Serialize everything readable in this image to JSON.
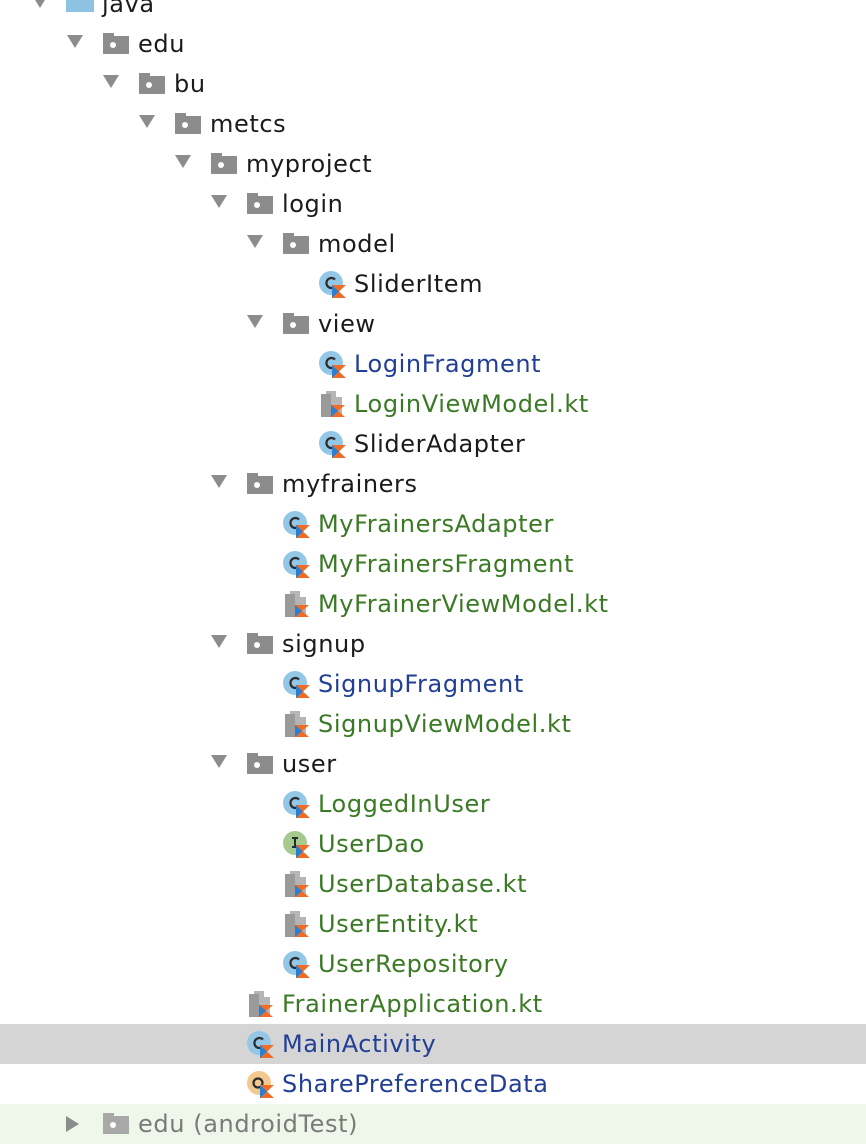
{
  "tree": {
    "nodes": [
      {
        "label": "java",
        "kind": "folder"
      },
      {
        "label": "edu",
        "kind": "package"
      },
      {
        "label": "bu",
        "kind": "package"
      },
      {
        "label": "metcs",
        "kind": "package"
      },
      {
        "label": "myproject",
        "kind": "package"
      },
      {
        "label": "login",
        "kind": "package"
      },
      {
        "label": "model",
        "kind": "package"
      },
      {
        "label": "SliderItem",
        "kind": "kotlin-class"
      },
      {
        "label": "view",
        "kind": "package"
      },
      {
        "label": "LoginFragment",
        "kind": "kotlin-class"
      },
      {
        "label": "LoginViewModel.kt",
        "kind": "kotlin-file"
      },
      {
        "label": "SliderAdapter",
        "kind": "kotlin-class"
      },
      {
        "label": "myfrainers",
        "kind": "package"
      },
      {
        "label": "MyFrainersAdapter",
        "kind": "kotlin-class"
      },
      {
        "label": "MyFrainersFragment",
        "kind": "kotlin-class"
      },
      {
        "label": "MyFrainerViewModel.kt",
        "kind": "kotlin-file"
      },
      {
        "label": "signup",
        "kind": "package"
      },
      {
        "label": "SignupFragment",
        "kind": "kotlin-class"
      },
      {
        "label": "SignupViewModel.kt",
        "kind": "kotlin-file"
      },
      {
        "label": "user",
        "kind": "package"
      },
      {
        "label": "LoggedInUser",
        "kind": "kotlin-class"
      },
      {
        "label": "UserDao",
        "kind": "kotlin-interface"
      },
      {
        "label": "UserDatabase.kt",
        "kind": "kotlin-file"
      },
      {
        "label": "UserEntity.kt",
        "kind": "kotlin-file"
      },
      {
        "label": "UserRepository",
        "kind": "kotlin-class"
      },
      {
        "label": "FrainerApplication.kt",
        "kind": "kotlin-file"
      },
      {
        "label": "MainActivity",
        "kind": "kotlin-class",
        "selected": true
      },
      {
        "label": "SharePreferenceData",
        "kind": "kotlin-object"
      },
      {
        "label": "edu (androidTest)",
        "kind": "package"
      }
    ]
  },
  "colors": {
    "default_text": "#1b1b1b",
    "modified_blue": "#223f95",
    "added_green": "#3b7a24",
    "selection": "#d5d5d5"
  }
}
